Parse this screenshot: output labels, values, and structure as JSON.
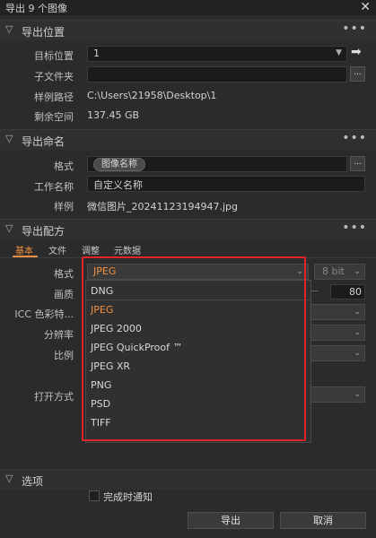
{
  "window": {
    "title": "导出 9 个图像",
    "close_glyph": "✕"
  },
  "sections": {
    "location": {
      "title": "导出位置",
      "target_label": "目标位置",
      "target_value": "1",
      "subfolder_label": "子文件夹",
      "subfolder_value": "",
      "sample_path_label": "样例路径",
      "sample_path_value": "C:\\Users\\21958\\Desktop\\1",
      "free_space_label": "剩余空间",
      "free_space_value": "137.45 GB",
      "browse_button": "..."
    },
    "naming": {
      "title": "导出命名",
      "format_label": "格式",
      "format_token": "图像名称",
      "job_name_label": "工作名称",
      "job_name_value": "自定义名称",
      "sample_label": "样例",
      "sample_value": "微信图片_20241123194947.jpg",
      "browse_button": "..."
    },
    "recipe": {
      "title": "导出配方",
      "tabs": [
        "基本",
        "文件",
        "调整",
        "元数据"
      ],
      "format_label": "格式",
      "format_value": "JPEG",
      "bit_value": "8 bit",
      "quality_label": "画质",
      "quality_value": "80",
      "icc_label": "ICC 色彩特...",
      "resolution_label": "分辨率",
      "ratio_label": "比例",
      "open_with_label": "打开方式",
      "format_options": [
        "DNG",
        "JPEG",
        "JPEG 2000",
        "JPEG QuickProof ™",
        "JPEG XR",
        "PNG",
        "PSD",
        "TIFF"
      ],
      "selected_option": "JPEG"
    },
    "options": {
      "title": "选项",
      "notify_label": "完成时通知"
    }
  },
  "footer": {
    "export_button": "导出",
    "cancel_button": "取消"
  },
  "colors": {
    "accent": "#f09040",
    "highlight_frame": "#e0242c",
    "background": "#2b2b2b"
  },
  "icons": {
    "section_chevron": "chevron-down-icon",
    "more": "more-dots-icon",
    "arrow": "arrow-right-icon"
  }
}
